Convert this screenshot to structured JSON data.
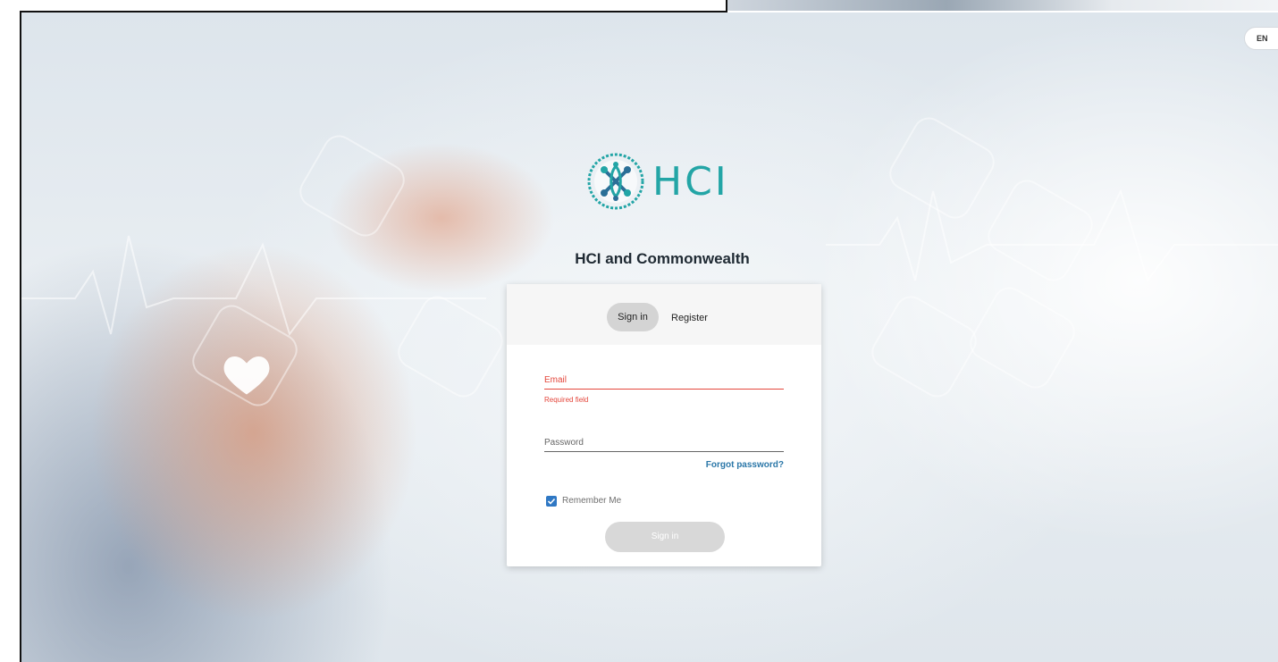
{
  "language": {
    "label": "EN"
  },
  "brand": {
    "logo_text": "HCI",
    "subtitle": "HCI and Commonwealth"
  },
  "tabs": {
    "sign_in": "Sign in",
    "register": "Register"
  },
  "form": {
    "email_label": "Email",
    "email_error": "Required field",
    "password_label": "Password",
    "forgot_password": "Forgot password?",
    "remember_me": "Remember Me",
    "remember_checked": true,
    "submit_label": "Sign in"
  },
  "colors": {
    "brand_teal": "#23a5a6",
    "error_red": "#e4473c",
    "link_blue": "#2b77a8",
    "checkbox_blue": "#2f78c4"
  }
}
